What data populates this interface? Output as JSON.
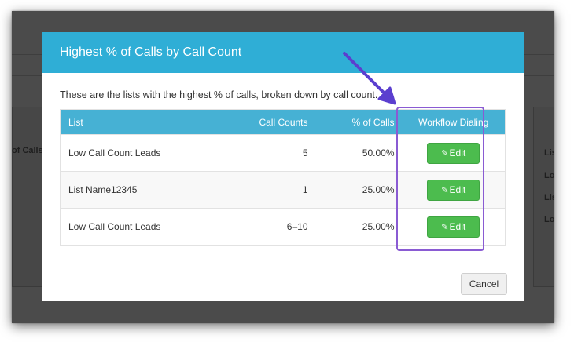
{
  "modal": {
    "title": "Highest % of Calls by Call Count",
    "description": "These are the lists with the highest % of calls, broken down by call count.",
    "table": {
      "headers": [
        "List",
        "Call Counts",
        "% of Calls",
        "Workflow Dialing"
      ],
      "rows": [
        {
          "list": "Low Call Count Leads",
          "call_counts": "5",
          "pct_calls": "50.00%",
          "action": "Edit"
        },
        {
          "list": "List Name12345",
          "call_counts": "1",
          "pct_calls": "25.00%",
          "action": "Edit"
        },
        {
          "list": "Low Call Count Leads",
          "call_counts": "6–10",
          "pct_calls": "25.00%",
          "action": "Edit"
        }
      ]
    },
    "cancel_label": "Cancel"
  },
  "background": {
    "left_fragment": "of Calls",
    "right_fragments": [
      "Lis",
      "Lo",
      "Lis",
      "Lo"
    ]
  },
  "icons": {
    "edit": "edit-icon"
  },
  "colors": {
    "header": "#2faed6",
    "table_header": "#46b1d4",
    "edit_button": "#4cbc4e",
    "annotation": "#8a5bd3"
  }
}
